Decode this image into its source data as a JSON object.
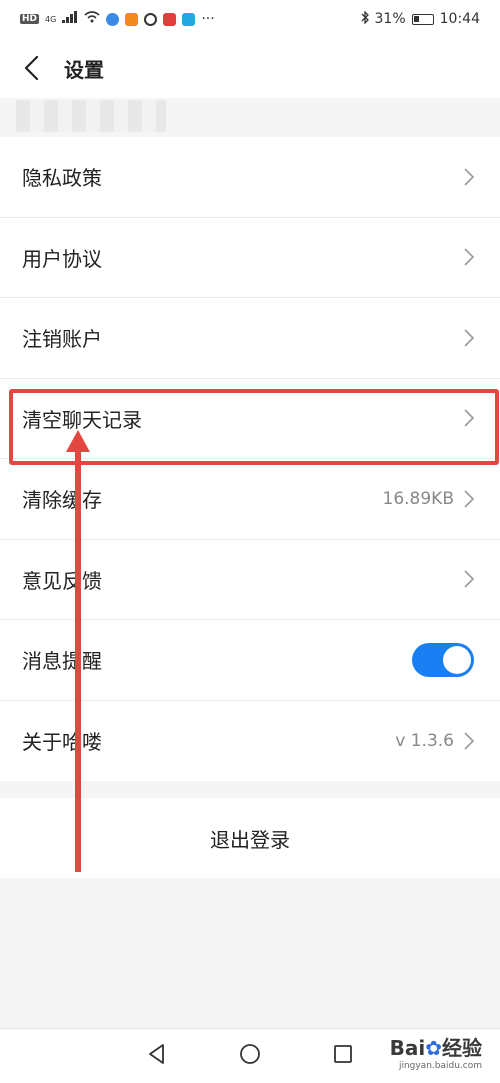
{
  "status_bar": {
    "left_tags": [
      "HD",
      "4G"
    ],
    "more": "···",
    "battery": "31%",
    "time": "10:44",
    "battery_level": 0.31
  },
  "header": {
    "title": "设置"
  },
  "settings": {
    "items": [
      {
        "label": "隐私政策",
        "value": ""
      },
      {
        "label": "用户协议",
        "value": ""
      },
      {
        "label": "注销账户",
        "value": ""
      },
      {
        "label": "清空聊天记录",
        "value": ""
      },
      {
        "label": "清除缓存",
        "value": "16.89KB"
      },
      {
        "label": "意见反馈",
        "value": ""
      },
      {
        "label": "消息提醒",
        "value": "",
        "toggle": true
      },
      {
        "label": "关于哈喽",
        "value": "v 1.3.6"
      }
    ]
  },
  "logout": {
    "label": "退出登录"
  },
  "watermark": {
    "logo": "Bai",
    "logo_suffix": "经验",
    "url": "jingyan.baidu.com"
  },
  "colors": {
    "toggle_on": "#1a7ff2",
    "annotation_red": "#e4473f"
  }
}
